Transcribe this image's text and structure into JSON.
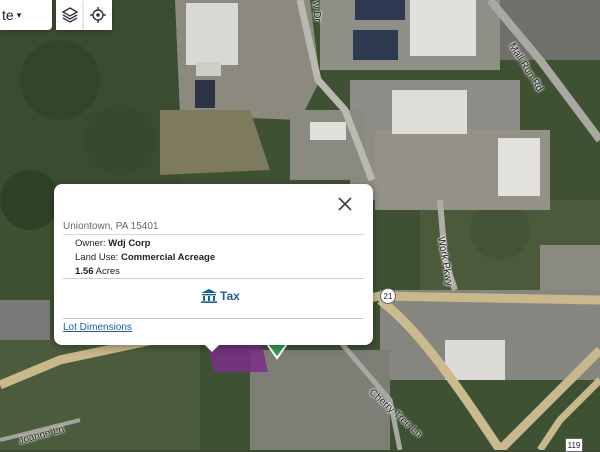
{
  "map_type": {
    "label": "te",
    "caret": "▾"
  },
  "controls": {
    "layers": "layers-icon",
    "locate": "locate-icon"
  },
  "road_labels": {
    "ew_dr": "w Dr",
    "mall_run": "Mall Run Rd",
    "work_pkwy": "Work Pkwy",
    "cherry_tree": "Cherry Tree Ln",
    "joanne": "Joanne Ln",
    "rt21": "21",
    "rt119": "119"
  },
  "popup": {
    "address": "Uniontown, PA 15401",
    "owner_label": "Owner:",
    "owner": "Wdj Corp",
    "land_use_label": "Land Use:",
    "land_use": "Commercial Acreage",
    "acres": "1.56",
    "acres_unit": "Acres",
    "tax_label": "Tax",
    "lot_dimensions": "Lot Dimensions"
  },
  "colors": {
    "link": "#1a5fa6",
    "parcel": "#7a2e86",
    "marker": "#2e9e4f"
  }
}
